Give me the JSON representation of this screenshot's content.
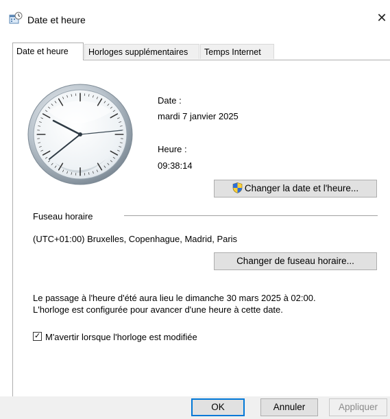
{
  "window": {
    "title": "Date et heure",
    "close_label": "✕"
  },
  "tabs": [
    {
      "label": "Date et heure"
    },
    {
      "label": "Horloges supplémentaires"
    },
    {
      "label": "Temps Internet"
    }
  ],
  "datetime": {
    "date_label": "Date :",
    "date_value": "mardi 7 janvier 2025",
    "time_label": "Heure :",
    "time_value": "09:38:14",
    "change_button": "Changer la date et l'heure..."
  },
  "timezone": {
    "section_label": "Fuseau horaire",
    "value": "(UTC+01:00) Bruxelles, Copenhague, Madrid, Paris",
    "change_button": "Changer de fuseau horaire..."
  },
  "dst": {
    "line1": "Le passage à l'heure d'été aura lieu le dimanche 30 mars 2025 à 02:00.",
    "line2": "L'horloge est configurée pour avancer d'une heure à cette date."
  },
  "notify": {
    "label": "M'avertir lorsque l'horloge est modifiée",
    "checked": true
  },
  "buttons": {
    "ok": "OK",
    "cancel": "Annuler",
    "apply": "Appliquer"
  },
  "icons": {
    "window": "date-time-icon",
    "shield": "uac-shield-icon"
  }
}
